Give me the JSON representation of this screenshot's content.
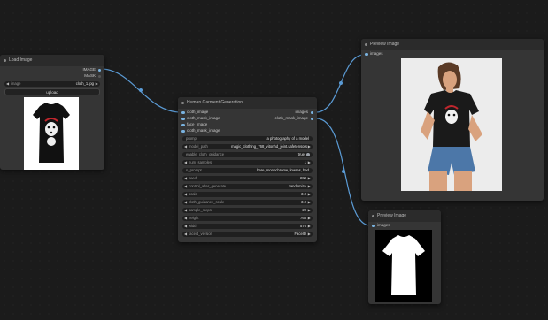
{
  "load_image": {
    "title": "Load Image",
    "outputs": [
      "IMAGE",
      "MASK"
    ],
    "image_label": "image",
    "image_value": "cloth_1.jpg",
    "upload_label": "upload"
  },
  "garment": {
    "title": "Human Garment Generation",
    "inputs": [
      "cloth_image",
      "cloth_mask_image",
      "face_image",
      "cloth_mask_image"
    ],
    "outputs": [
      "images",
      "cloth_mask_image"
    ],
    "widgets": [
      {
        "label": "prompt",
        "value": "a photography of a model",
        "kind": "text"
      },
      {
        "label": "model_path",
        "value": "magic_clothing_768_vitonhd_joint.safetensors",
        "kind": "combo"
      },
      {
        "label": "enable_cloth_guidance",
        "value": "true",
        "kind": "toggle"
      },
      {
        "label": "num_samples",
        "value": "1",
        "kind": "number"
      },
      {
        "label": "n_prompt",
        "value": "bare, monochrome, lowres, bad",
        "kind": "text"
      },
      {
        "label": "seed",
        "value": "690",
        "kind": "number"
      },
      {
        "label": "control_after_generate",
        "value": "randomize",
        "kind": "combo"
      },
      {
        "label": "scale",
        "value": "3.0",
        "kind": "number"
      },
      {
        "label": "cloth_guidance_scale",
        "value": "3.0",
        "kind": "number"
      },
      {
        "label": "sample_steps",
        "value": "20",
        "kind": "number"
      },
      {
        "label": "height",
        "value": "768",
        "kind": "number"
      },
      {
        "label": "width",
        "value": "576",
        "kind": "number"
      },
      {
        "label": "faceid_version",
        "value": "FaceID",
        "kind": "combo"
      }
    ]
  },
  "preview1": {
    "title": "Preview Image",
    "input": "images"
  },
  "preview2": {
    "title": "Preview Image",
    "input": "images"
  },
  "colors": {
    "wire": "#5b9bd5",
    "node_bg": "#353535",
    "title_bg": "#2b2b2b"
  }
}
